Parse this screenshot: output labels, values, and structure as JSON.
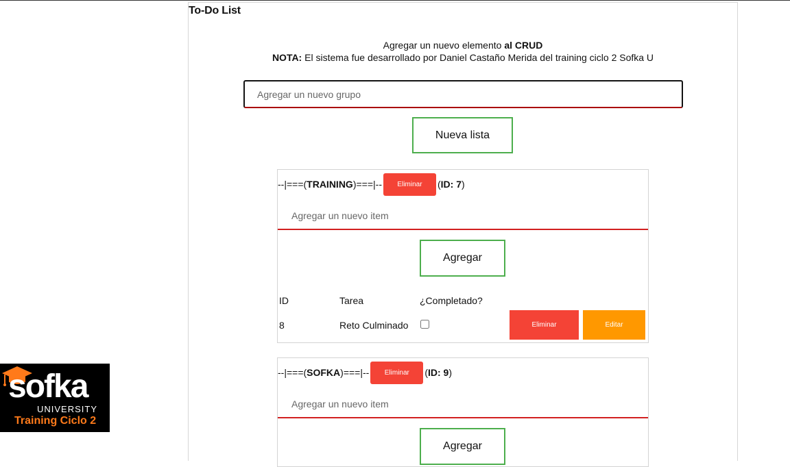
{
  "app": {
    "title": "To-Do List"
  },
  "intro": {
    "line1_prefix": "Agregar un nuevo elemento ",
    "line1_bold": "al CRUD",
    "line2_bold": "NOTA:",
    "line2_text": " El sistema fue desarrollado por Daniel Castaño Merida del training ciclo 2 Sofka U"
  },
  "new_group": {
    "placeholder": "Agregar un nuevo grupo",
    "button_label": "Nueva lista"
  },
  "lists": [
    {
      "prefix": "--|===(",
      "name": "TRAINING",
      "suffix": ")===|--",
      "delete_label": "Eliminar",
      "id_open": "(",
      "id_label": "ID: 7",
      "id_close": ")",
      "item_placeholder": "Agregar un nuevo item",
      "add_label": "Agregar",
      "columns": [
        "ID",
        "Tarea",
        "¿Completado?"
      ],
      "rows": [
        {
          "id": "8",
          "task": "Reto Culminado",
          "completed": false,
          "delete_label": "Eliminar",
          "edit_label": "Editar"
        }
      ]
    },
    {
      "prefix": "--|===(",
      "name": "SOFKA",
      "suffix": ")===|--",
      "delete_label": "Eliminar",
      "id_open": "(",
      "id_label": "ID: 9",
      "id_close": ")",
      "item_placeholder": "Agregar un nuevo item",
      "add_label": "Agregar"
    }
  ],
  "logo": {
    "wordmark": "sofka",
    "sub": "UNIVERSITY",
    "tagline": "Training Ciclo 2"
  },
  "colors": {
    "danger": "#f44336",
    "warning": "#ff9800",
    "success_border": "#4cae4c",
    "accent_orange": "#ff7a1a",
    "underline_red": "#d21f1f"
  }
}
